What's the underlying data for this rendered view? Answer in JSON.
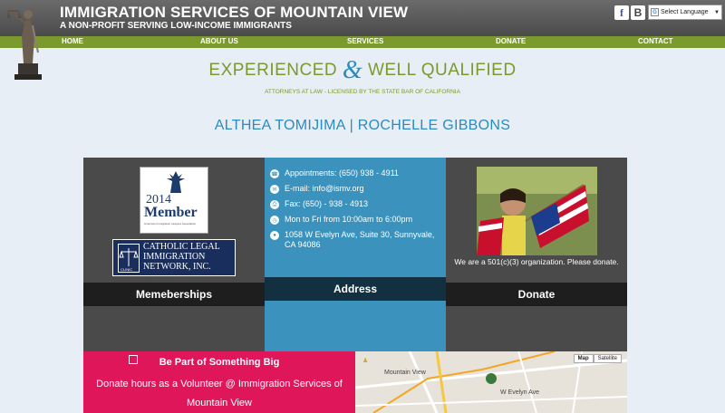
{
  "header": {
    "title": "IMMIGRATION SERVICES OF MOUNTAIN VIEW",
    "subtitle": "A NON-PROFIT SERVING LOW-INCOME IMMIGRANTS",
    "language_select": "Select Language"
  },
  "nav": {
    "items": [
      "HOME",
      "ABOUT US",
      "SERVICES",
      "DONATE",
      "CONTACT"
    ]
  },
  "hero": {
    "tagline_left": "EXPERIENCED",
    "tagline_amp": "&",
    "tagline_right": "WELL QUALIFIED",
    "licensed": "ATTORNEYS AT LAW - LICENSED BY THE STATE BAR OF CALIFORNIA",
    "names": "ALTHEA TOMIJIMA | ROCHELLE GIBBONS"
  },
  "memberships": {
    "badge_year": "2014",
    "badge_word": "Member",
    "badge_org": "American Immigration Lawyers Association",
    "clinic_logo": "CATHOLIC LEGAL IMMIGRATION NETWORK, INC.",
    "bar_label": "Memeberships"
  },
  "address": {
    "appointments": "Appointments: (650) 938 - 4911",
    "email": "E-mail: info@ismv.org",
    "fax": "Fax: (650) - 938 - 4913",
    "hours": "Mon to Fri from 10:00am to 6:00pm",
    "street": "1058 W Evelyn Ave, Suite 30, Sunnyvale,",
    "city": "CA 94086",
    "bar_label": "Address"
  },
  "donate": {
    "text": "We are a 501(c)(3) organization. Please donate.",
    "bar_label": "Donate"
  },
  "volunteer": {
    "heading": "Be Part of Something Big",
    "text": "Donate hours as a Volunteer @ Immigration Services of Mountain View"
  },
  "map": {
    "btn_map": "Map",
    "btn_satellite": "Satellite",
    "label_city": "Mountain View",
    "label_street": "W Evelyn Ave"
  },
  "colors": {
    "header_bg": "#555555",
    "nav_green": "#7a9a2e",
    "accent_blue": "#2a8bbf",
    "volunteer_pink": "#e0165a"
  }
}
